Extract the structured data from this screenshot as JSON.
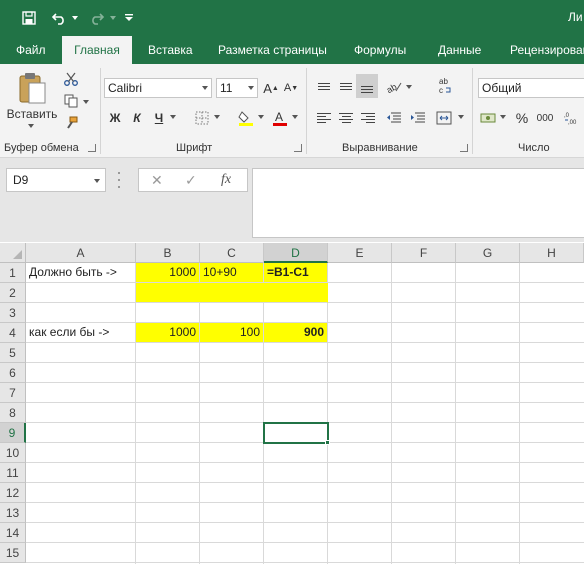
{
  "title": "Ли",
  "tabs": [
    "Файл",
    "Главная",
    "Вставка",
    "Разметка страницы",
    "Формулы",
    "Данные",
    "Рецензирование"
  ],
  "ribbon": {
    "clipboard": {
      "paste_label": "Вставить",
      "group_label": "Буфер обмена"
    },
    "font": {
      "name": "Calibri",
      "size": "11",
      "bold": "Ж",
      "italic": "К",
      "underline": "Ч",
      "group_label": "Шрифт"
    },
    "alignment": {
      "group_label": "Выравнивание"
    },
    "number": {
      "format": "Общий",
      "group_label": "Число"
    }
  },
  "formula_bar": {
    "name_box": "D9",
    "cancel": "✕",
    "enter": "✓",
    "fx": "fx",
    "formula": ""
  },
  "columns": [
    "A",
    "B",
    "C",
    "D",
    "E",
    "F",
    "G",
    "H"
  ],
  "rows": [
    "1",
    "2",
    "3",
    "4",
    "5",
    "6",
    "7",
    "8",
    "9",
    "10",
    "11",
    "12",
    "13",
    "14",
    "15"
  ],
  "selected_cell": "D9",
  "cells": {
    "A1": "Должно быть ->",
    "B1": "1000",
    "C1": "10+90",
    "D1": "=B1-C1",
    "A4": "как если бы ->",
    "B4": "1000",
    "C4": "100",
    "D4": "900"
  },
  "colors": {
    "excel_green": "#217346",
    "highlight": "#ffff00"
  }
}
